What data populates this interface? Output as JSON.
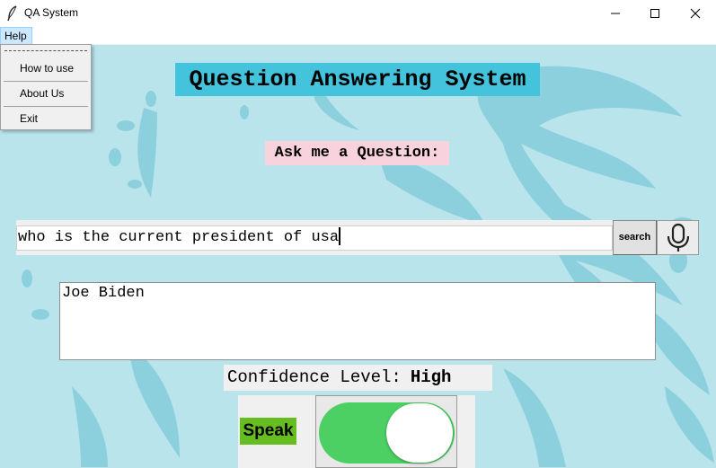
{
  "window": {
    "title": "QA System",
    "icon": "feather-icon",
    "controls": [
      "minimize-icon",
      "maximize-icon",
      "close-icon"
    ]
  },
  "menubar": {
    "help_label": "Help"
  },
  "help_menu": {
    "items": [
      {
        "label": "How to use"
      },
      {
        "label": "About Us"
      },
      {
        "label": "Exit"
      }
    ]
  },
  "main": {
    "title": "Question Answering System",
    "prompt": "Ask me a Question:",
    "query_value": "who is the current president of usa",
    "search_label": "search",
    "mic_icon": "microphone-icon",
    "answer": "Joe Biden",
    "confidence_label": "Confidence Level:",
    "confidence_value": "High",
    "speak_label": "Speak",
    "speak_toggle_on": true
  },
  "colors": {
    "background": "#b9e4ec",
    "title_bg": "#44c3dc",
    "prompt_bg": "#f8d3dd",
    "speak_bg": "#66bd1f",
    "toggle_on": "#4cd064"
  }
}
